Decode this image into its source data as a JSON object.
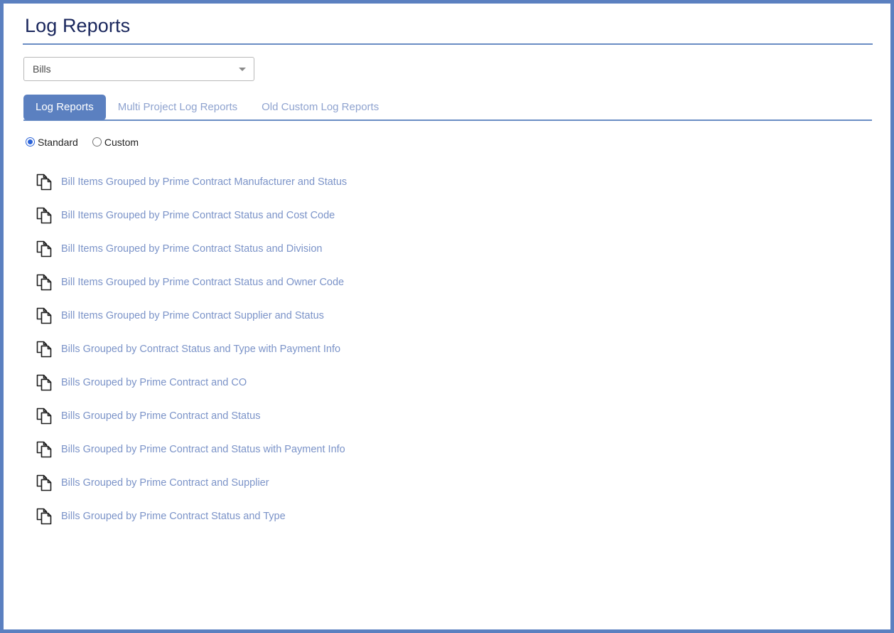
{
  "page": {
    "title": "Log Reports",
    "frame_color": "#5b80c0",
    "title_color": "#19265c",
    "link_color": "#7b93c8"
  },
  "module_select": {
    "name": "module-select",
    "value": "Bills",
    "caret_icon": "chevron-down-icon"
  },
  "tabs": [
    {
      "label": "Log Reports",
      "active": true
    },
    {
      "label": "Multi Project Log Reports",
      "active": false
    },
    {
      "label": "Old Custom Log Reports",
      "active": false
    }
  ],
  "report_type": {
    "options": [
      {
        "label": "Standard",
        "checked": true
      },
      {
        "label": "Custom",
        "checked": false
      }
    ]
  },
  "reports": {
    "icon": "copy-documents-icon",
    "items": [
      {
        "label": "Bill Items Grouped by Prime Contract Manufacturer and Status"
      },
      {
        "label": "Bill Items Grouped by Prime Contract Status and Cost Code"
      },
      {
        "label": "Bill Items Grouped by Prime Contract Status and Division"
      },
      {
        "label": "Bill Items Grouped by Prime Contract Status and Owner Code"
      },
      {
        "label": "Bill Items Grouped by Prime Contract Supplier and Status"
      },
      {
        "label": "Bills Grouped by Contract Status and Type with Payment Info"
      },
      {
        "label": "Bills Grouped by Prime Contract and CO"
      },
      {
        "label": "Bills Grouped by Prime Contract and Status"
      },
      {
        "label": "Bills Grouped by Prime Contract and Status with Payment Info"
      },
      {
        "label": "Bills Grouped by Prime Contract and Supplier"
      },
      {
        "label": "Bills Grouped by Prime Contract Status and Type"
      }
    ]
  }
}
